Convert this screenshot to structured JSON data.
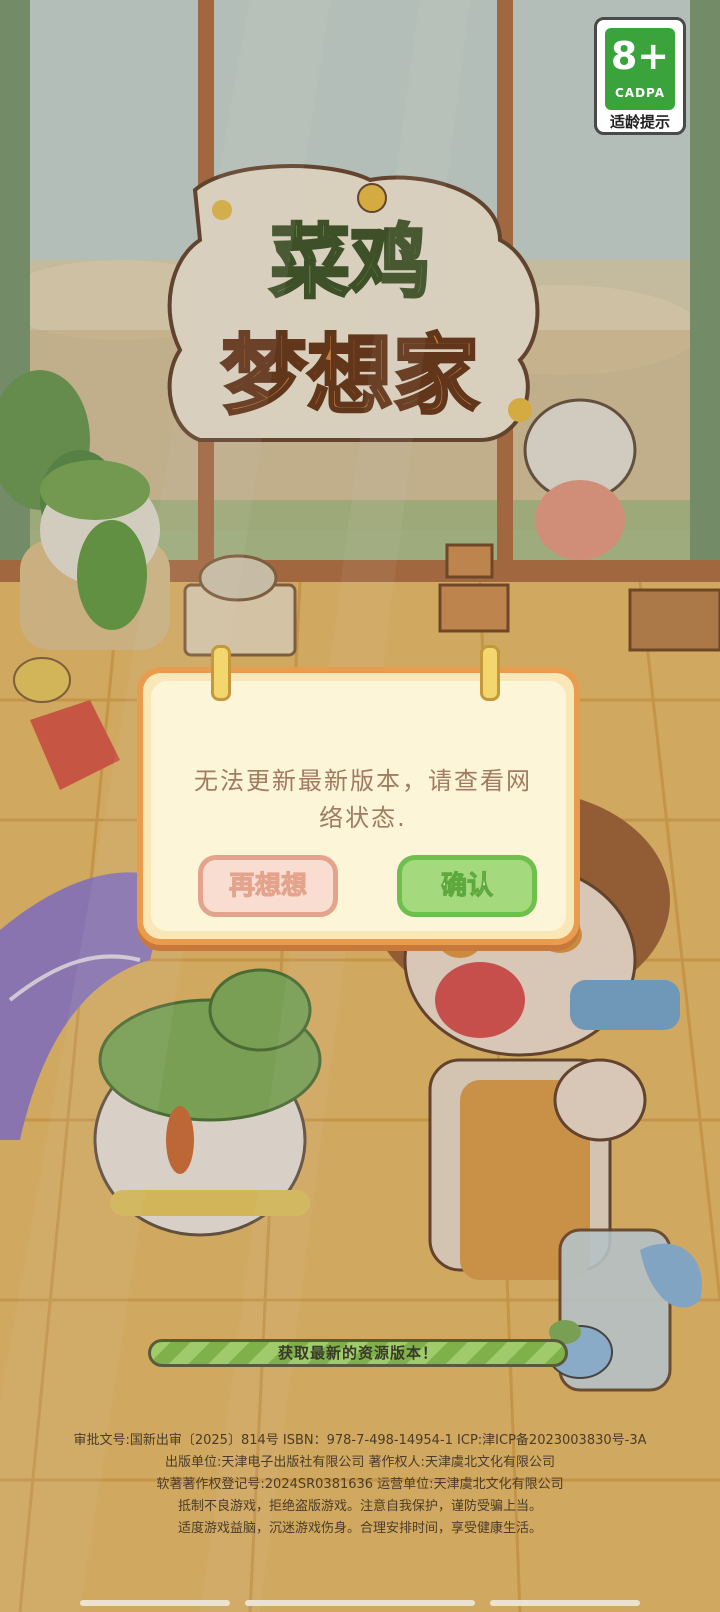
{
  "age_rating": {
    "number": "8+",
    "org": "CADPA",
    "tip": "适龄提示"
  },
  "logo": {
    "title_line1": "菜鸡",
    "title_line2": "梦想家"
  },
  "dialog": {
    "message": "无法更新最新版本，请查看网络状态.",
    "cancel_label": "再想想",
    "confirm_label": "确认"
  },
  "progress": {
    "text": "获取最新的资源版本！"
  },
  "legal": {
    "line1": "审批文号:国新出审〔2025〕814号  ISBN：978-7-498-14954-1 ICP:津ICP备2023003830号-3A",
    "line2": "出版单位:天津电子出版社有限公司  著作权人:天津虞北文化有限公司",
    "line3": "软著著作权登记号:2024SR0381636  运营单位:天津虞北文化有限公司",
    "line4": "抵制不良游戏，拒绝盗版游戏。注意自我保护，谨防受骗上当。",
    "line5": "适度游戏益脑，沉迷游戏伤身。合理安排时间，享受健康生活。"
  },
  "colors": {
    "dialog_border": "#e99c4e",
    "confirm_green": "#a5d97d",
    "cancel_pink": "#f8ddd0",
    "age_green": "#3aa33c"
  }
}
